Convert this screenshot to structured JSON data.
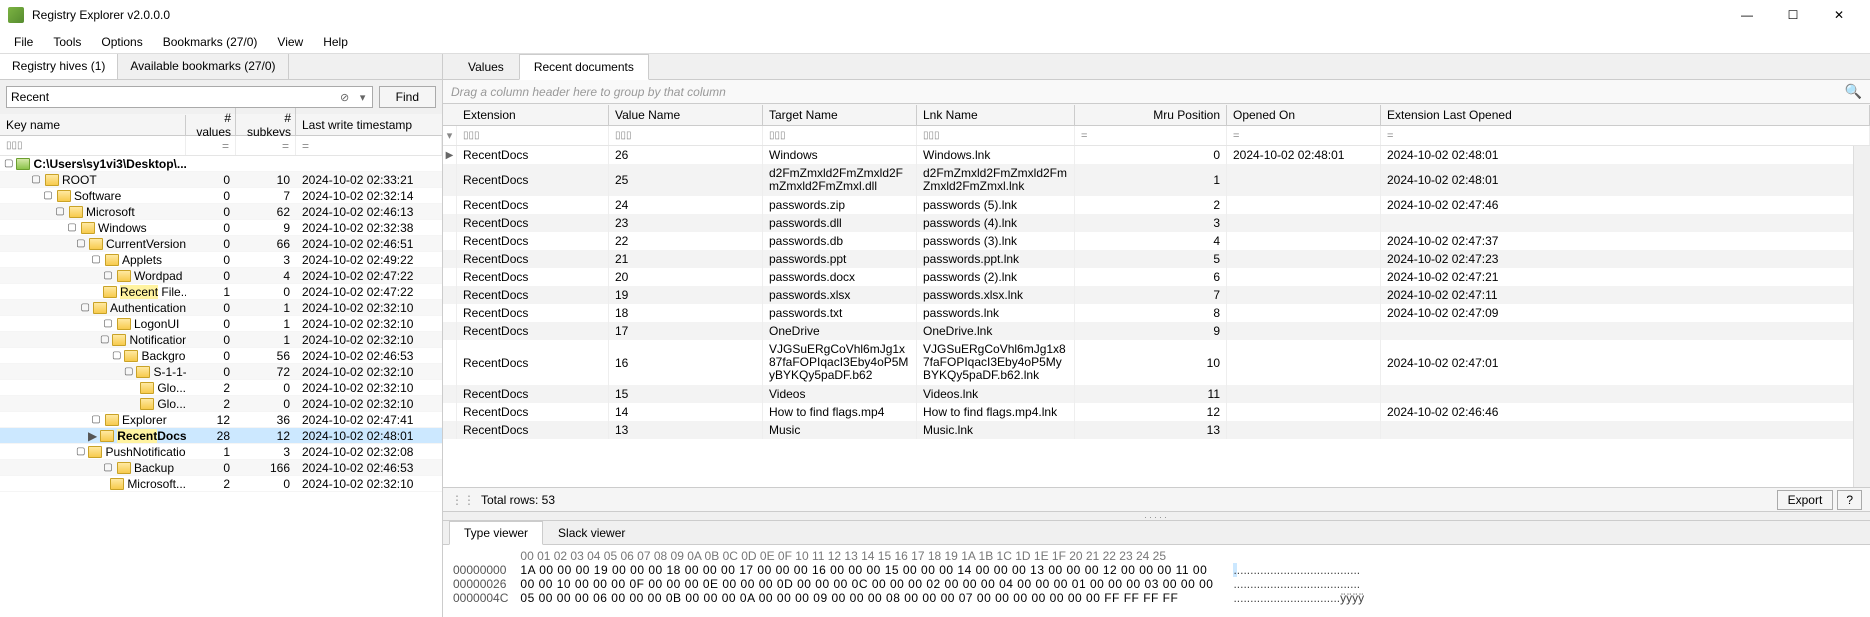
{
  "window": {
    "title": "Registry Explorer v2.0.0.0"
  },
  "menu": [
    "File",
    "Tools",
    "Options",
    "Bookmarks (27/0)",
    "View",
    "Help"
  ],
  "left_tabs": [
    "Registry hives (1)",
    "Available bookmarks (27/0)"
  ],
  "search": {
    "value": "Recent",
    "find_label": "Find"
  },
  "tree_headers": {
    "key": "Key name",
    "values": "# values",
    "subkeys": "# subkeys",
    "ts": "Last write timestamp"
  },
  "tree_filter": {
    "values": "=",
    "subkeys": "=",
    "ts": "="
  },
  "tree": [
    {
      "indent": 0,
      "exp": "▢",
      "icon": "drive",
      "label": "C:\\Users\\sy1vi3\\Desktop\\...",
      "v": "",
      "s": "",
      "ts": "",
      "bold": true
    },
    {
      "indent": 1,
      "exp": "▢",
      "icon": "folder",
      "label": "ROOT",
      "v": "0",
      "s": "10",
      "ts": "2024-10-02 02:33:21"
    },
    {
      "indent": 2,
      "exp": "▢",
      "icon": "folder",
      "label": "Software",
      "v": "0",
      "s": "7",
      "ts": "2024-10-02 02:32:14"
    },
    {
      "indent": 3,
      "exp": "▢",
      "icon": "folder",
      "label": "Microsoft",
      "v": "0",
      "s": "62",
      "ts": "2024-10-02 02:46:13"
    },
    {
      "indent": 4,
      "exp": "▢",
      "icon": "folder",
      "label": "Windows",
      "v": "0",
      "s": "9",
      "ts": "2024-10-02 02:32:38"
    },
    {
      "indent": 5,
      "exp": "▢",
      "icon": "folder",
      "label": "CurrentVersion",
      "v": "0",
      "s": "66",
      "ts": "2024-10-02 02:46:51"
    },
    {
      "indent": 6,
      "exp": "▢",
      "icon": "folder",
      "label": "Applets",
      "v": "0",
      "s": "3",
      "ts": "2024-10-02 02:49:22"
    },
    {
      "indent": 7,
      "exp": "▢",
      "icon": "folder",
      "label": "Wordpad",
      "v": "0",
      "s": "4",
      "ts": "2024-10-02 02:47:22"
    },
    {
      "indent": 8,
      "exp": "",
      "icon": "folder",
      "label": "Recent File...",
      "v": "1",
      "s": "0",
      "ts": "2024-10-02 02:47:22",
      "hl": "Recent"
    },
    {
      "indent": 6,
      "exp": "▢",
      "icon": "folder",
      "label": "Authentication",
      "v": "0",
      "s": "1",
      "ts": "2024-10-02 02:32:10"
    },
    {
      "indent": 7,
      "exp": "▢",
      "icon": "folder",
      "label": "LogonUI",
      "v": "0",
      "s": "1",
      "ts": "2024-10-02 02:32:10"
    },
    {
      "indent": 8,
      "exp": "▢",
      "icon": "folder",
      "label": "Notifications",
      "v": "0",
      "s": "1",
      "ts": "2024-10-02 02:32:10"
    },
    {
      "indent": 9,
      "exp": "▢",
      "icon": "folder",
      "label": "Backgro...",
      "v": "0",
      "s": "56",
      "ts": "2024-10-02 02:46:53"
    },
    {
      "indent": 10,
      "exp": "▢",
      "icon": "folder",
      "label": "S-1-1-...",
      "v": "0",
      "s": "72",
      "ts": "2024-10-02 02:32:10"
    },
    {
      "indent": 11,
      "exp": "",
      "icon": "folder",
      "label": "Glo...",
      "v": "2",
      "s": "0",
      "ts": "2024-10-02 02:32:10"
    },
    {
      "indent": 11,
      "exp": "",
      "icon": "folder",
      "label": "Glo...",
      "v": "2",
      "s": "0",
      "ts": "2024-10-02 02:32:10"
    },
    {
      "indent": 6,
      "exp": "▢",
      "icon": "folder",
      "label": "Explorer",
      "v": "12",
      "s": "36",
      "ts": "2024-10-02 02:47:41"
    },
    {
      "indent": 7,
      "exp": "",
      "icon": "folder",
      "label": "RecentDocs",
      "v": "28",
      "s": "12",
      "ts": "2024-10-02 02:48:01",
      "hl": "Recent",
      "selected": true,
      "bold": true,
      "arrow": true
    },
    {
      "indent": 6,
      "exp": "▢",
      "icon": "folder",
      "label": "PushNotifications",
      "v": "1",
      "s": "3",
      "ts": "2024-10-02 02:32:08"
    },
    {
      "indent": 7,
      "exp": "▢",
      "icon": "folder",
      "label": "Backup",
      "v": "0",
      "s": "166",
      "ts": "2024-10-02 02:46:53"
    },
    {
      "indent": 8,
      "exp": "",
      "icon": "folder",
      "label": "Microsoft...",
      "v": "2",
      "s": "0",
      "ts": "2024-10-02 02:32:10"
    }
  ],
  "right_tabs": [
    "Values",
    "Recent documents"
  ],
  "group_hint": "Drag a column header here to group by that column",
  "grid_headers": [
    "Extension",
    "Value Name",
    "Target Name",
    "Lnk Name",
    "Mru Position",
    "Opened On",
    "Extension Last Opened"
  ],
  "grid_filter_ops": {
    "mru": "=",
    "open": "=",
    "last": "="
  },
  "grid_rows": [
    {
      "ext": "RecentDocs",
      "vn": "26",
      "tn": "Windows",
      "ln": "Windows.lnk",
      "mru": "0",
      "open": "2024-10-02 02:48:01",
      "last": "2024-10-02 02:48:01",
      "arrow": true
    },
    {
      "ext": "RecentDocs",
      "vn": "25",
      "tn": "d2FmZmxld2FmZmxld2FmZmxld2FmZmxl.dll",
      "ln": "d2FmZmxld2FmZmxld2FmZmxld2FmZmxl.lnk",
      "mru": "1",
      "open": "",
      "last": "2024-10-02 02:48:01",
      "wrap": true
    },
    {
      "ext": "RecentDocs",
      "vn": "24",
      "tn": "passwords.zip",
      "ln": "passwords (5).lnk",
      "mru": "2",
      "open": "",
      "last": "2024-10-02 02:47:46"
    },
    {
      "ext": "RecentDocs",
      "vn": "23",
      "tn": "passwords.dll",
      "ln": "passwords (4).lnk",
      "mru": "3",
      "open": "",
      "last": ""
    },
    {
      "ext": "RecentDocs",
      "vn": "22",
      "tn": "passwords.db",
      "ln": "passwords (3).lnk",
      "mru": "4",
      "open": "",
      "last": "2024-10-02 02:47:37"
    },
    {
      "ext": "RecentDocs",
      "vn": "21",
      "tn": "passwords.ppt",
      "ln": "passwords.ppt.lnk",
      "mru": "5",
      "open": "",
      "last": "2024-10-02 02:47:23"
    },
    {
      "ext": "RecentDocs",
      "vn": "20",
      "tn": "passwords.docx",
      "ln": "passwords (2).lnk",
      "mru": "6",
      "open": "",
      "last": "2024-10-02 02:47:21"
    },
    {
      "ext": "RecentDocs",
      "vn": "19",
      "tn": "passwords.xlsx",
      "ln": "passwords.xlsx.lnk",
      "mru": "7",
      "open": "",
      "last": "2024-10-02 02:47:11"
    },
    {
      "ext": "RecentDocs",
      "vn": "18",
      "tn": "passwords.txt",
      "ln": "passwords.lnk",
      "mru": "8",
      "open": "",
      "last": "2024-10-02 02:47:09"
    },
    {
      "ext": "RecentDocs",
      "vn": "17",
      "tn": "OneDrive",
      "ln": "OneDrive.lnk",
      "mru": "9",
      "open": "",
      "last": ""
    },
    {
      "ext": "RecentDocs",
      "vn": "16",
      "tn": "VJGSuERgCoVhl6mJg1x87faFOPIqacI3Eby4oP5MyBYKQy5paDF.b62",
      "ln": "VJGSuERgCoVhl6mJg1x87faFOPIqacI3Eby4oP5MyBYKQy5paDF.b62.lnk",
      "mru": "10",
      "open": "",
      "last": "2024-10-02 02:47:01",
      "wrap": true
    },
    {
      "ext": "RecentDocs",
      "vn": "15",
      "tn": "Videos",
      "ln": "Videos.lnk",
      "mru": "11",
      "open": "",
      "last": ""
    },
    {
      "ext": "RecentDocs",
      "vn": "14",
      "tn": "How to find flags.mp4",
      "ln": "How to find flags.mp4.lnk",
      "mru": "12",
      "open": "",
      "last": "2024-10-02 02:46:46"
    },
    {
      "ext": "RecentDocs",
      "vn": "13",
      "tn": "Music",
      "ln": "Music.lnk",
      "mru": "13",
      "open": "",
      "last": ""
    }
  ],
  "statusbar": {
    "total": "Total rows: 53",
    "export": "Export",
    "help": "?"
  },
  "bottom_tabs": [
    "Type viewer",
    "Slack viewer"
  ],
  "hex": {
    "header": "00 01 02 03 04 05 06 07 08 09 0A 0B 0C 0D 0E 0F 10 11 12 13 14 15 16 17 18 19 1A 1B 1C 1D 1E 1F 20 21 22 23 24 25",
    "lines": [
      {
        "off": "00000000",
        "bytes": "1A 00 00 00 19 00 00 00 18 00 00 00 17 00 00 00 16 00 00 00 15 00 00 00 14 00 00 00 13 00 00 00 12 00 00 00 11 00",
        "asc": "......................................"
      },
      {
        "off": "00000026",
        "bytes": "00 00 10 00 00 00 0F 00 00 00 0E 00 00 00 0D 00 00 00 0C 00 00 00 02 00 00 00 04 00 00 00 01 00 00 00 03 00 00 00",
        "asc": "......................................"
      },
      {
        "off": "0000004C",
        "bytes": "05 00 00 00 06 00 00 00 0B 00 00 00 0A 00 00 00 09 00 00 00 08 00 00 00 07 00 00 00 00 00 00 00 FF FF FF FF      ",
        "asc": "................................ÿÿÿÿ"
      }
    ]
  }
}
